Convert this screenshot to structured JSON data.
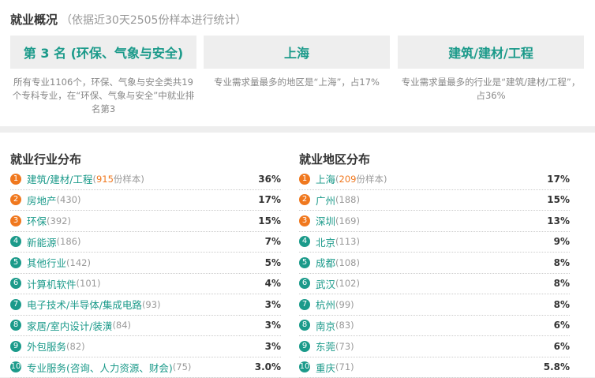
{
  "header": {
    "title": "就业概况",
    "note": "（依据近30天2505份样本进行统计）"
  },
  "cards": [
    {
      "value": "第 3 名 (环保、气象与安全)",
      "desc": "所有专业1106个，环保、气象与安全类共19个专科专业，在“环保、气象与安全”中就业排名第3"
    },
    {
      "value": "上海",
      "desc": "专业需求量最多的地区是“上海”，占17%"
    },
    {
      "value": "建筑/建材/工程",
      "desc": "专业需求量最多的行业是“建筑/建材/工程”，占36%"
    }
  ],
  "industry": {
    "title": "就业行业分布",
    "first_suffix": "份样本)",
    "items": [
      {
        "rank": "1",
        "name": "建筑/建材/工程",
        "count": "915",
        "pct": "36%"
      },
      {
        "rank": "2",
        "name": "房地产",
        "count": "(430)",
        "pct": "17%"
      },
      {
        "rank": "3",
        "name": "环保",
        "count": "(392)",
        "pct": "15%"
      },
      {
        "rank": "4",
        "name": "新能源",
        "count": "(186)",
        "pct": "7%"
      },
      {
        "rank": "5",
        "name": "其他行业",
        "count": "(142)",
        "pct": "5%"
      },
      {
        "rank": "6",
        "name": "计算机软件",
        "count": "(101)",
        "pct": "4%"
      },
      {
        "rank": "7",
        "name": "电子技术/半导体/集成电路",
        "count": "(93)",
        "pct": "3%"
      },
      {
        "rank": "8",
        "name": "家居/室内设计/装潢",
        "count": "(84)",
        "pct": "3%"
      },
      {
        "rank": "9",
        "name": "外包服务",
        "count": "(82)",
        "pct": "3%"
      },
      {
        "rank": "10",
        "name": "专业服务(咨询、人力资源、财会)",
        "count": "(75)",
        "pct": "3.0%"
      }
    ]
  },
  "region": {
    "title": "就业地区分布",
    "first_suffix": "份样本)",
    "items": [
      {
        "rank": "1",
        "name": "上海",
        "count": "209",
        "pct": "17%"
      },
      {
        "rank": "2",
        "name": "广州",
        "count": "(188)",
        "pct": "15%"
      },
      {
        "rank": "3",
        "name": "深圳",
        "count": "(169)",
        "pct": "13%"
      },
      {
        "rank": "4",
        "name": "北京",
        "count": "(113)",
        "pct": "9%"
      },
      {
        "rank": "5",
        "name": "成都",
        "count": "(108)",
        "pct": "8%"
      },
      {
        "rank": "6",
        "name": "武汉",
        "count": "(102)",
        "pct": "8%"
      },
      {
        "rank": "7",
        "name": "杭州",
        "count": "(99)",
        "pct": "8%"
      },
      {
        "rank": "8",
        "name": "南京",
        "count": "(83)",
        "pct": "6%"
      },
      {
        "rank": "9",
        "name": "东莞",
        "count": "(73)",
        "pct": "6%"
      },
      {
        "rank": "10",
        "name": "重庆",
        "count": "(71)",
        "pct": "5.8%"
      }
    ]
  },
  "colors": {
    "accent": "#1b9a8a",
    "highlight": "#f0781e",
    "muted": "#999999"
  }
}
